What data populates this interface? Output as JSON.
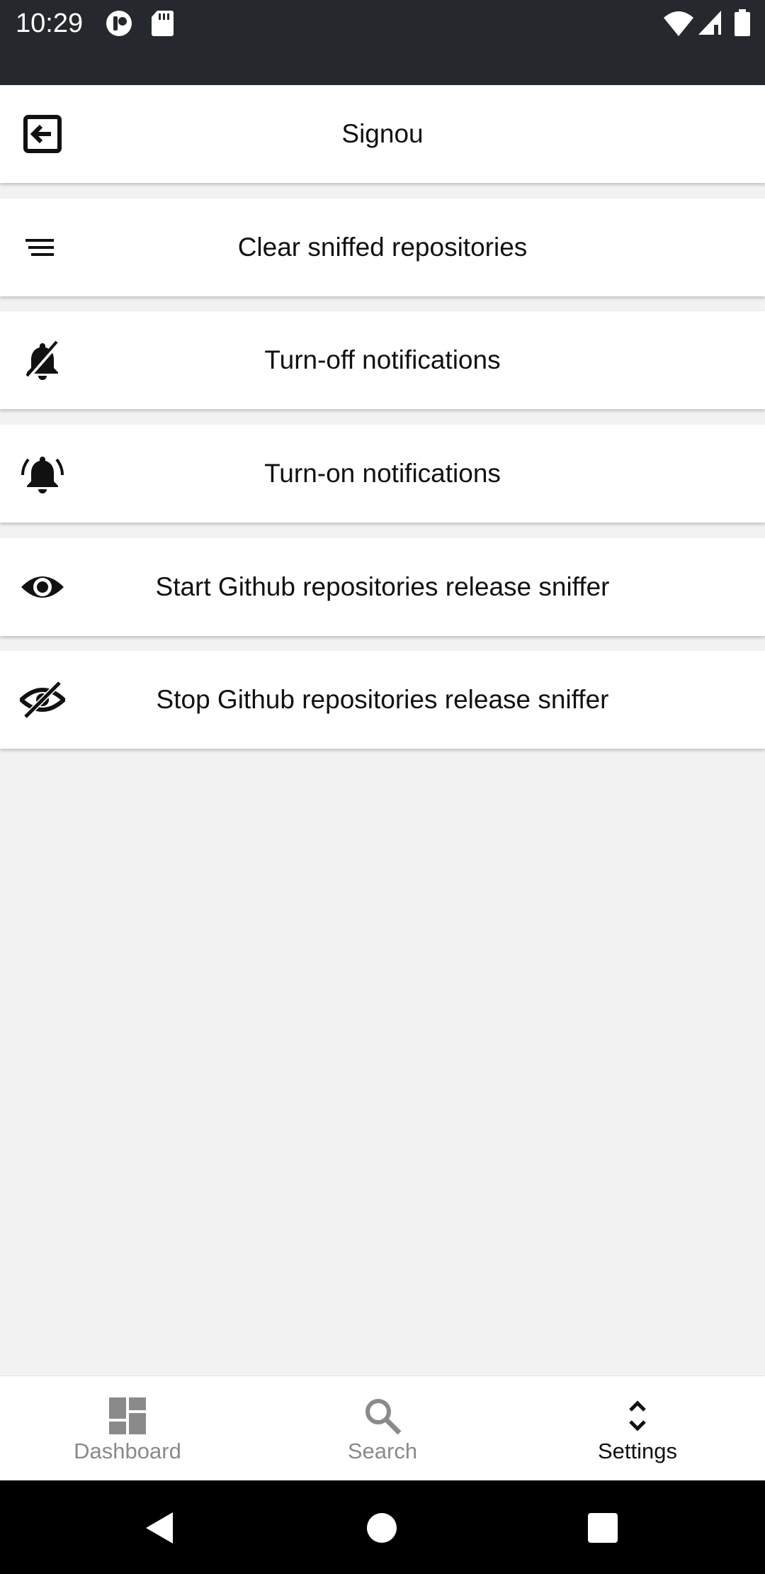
{
  "status_bar": {
    "time": "10:29",
    "icons": [
      "notification-app-icon",
      "sd-card-icon",
      "wifi-icon",
      "signal-icon",
      "battery-icon"
    ],
    "background": "#25282c"
  },
  "menu": {
    "items": [
      {
        "label": "Signou",
        "icon": "signout-icon"
      },
      {
        "label": "Clear sniffed repositories",
        "icon": "clear-list-icon"
      },
      {
        "label": "Turn-off notifications",
        "icon": "bell-off-icon"
      },
      {
        "label": "Turn-on notifications",
        "icon": "bell-ring-icon"
      },
      {
        "label": "Start Github repositories release sniffer",
        "icon": "eye-icon"
      },
      {
        "label": "Stop Github repositories release sniffer",
        "icon": "eye-off-icon"
      }
    ]
  },
  "bottom_nav": {
    "tabs": [
      {
        "label": "Dashboard",
        "icon": "dashboard-icon",
        "active": false
      },
      {
        "label": "Search",
        "icon": "search-icon",
        "active": false
      },
      {
        "label": "Settings",
        "icon": "unfold-icon",
        "active": true
      }
    ],
    "inactive_color": "#8a8a8a",
    "active_color": "#111111"
  },
  "system_nav": {
    "buttons": [
      "back-icon",
      "home-icon",
      "recents-icon"
    ]
  }
}
